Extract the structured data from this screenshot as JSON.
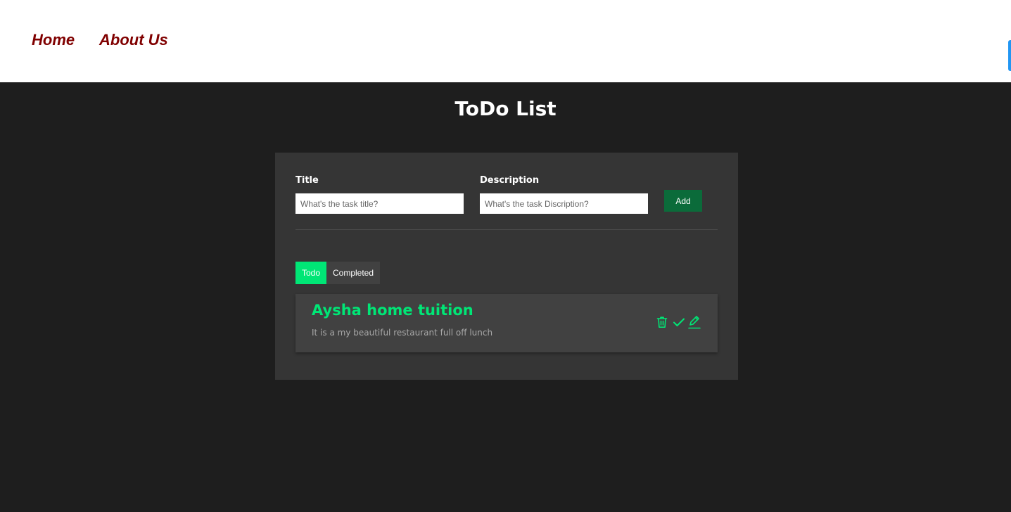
{
  "nav": {
    "home_label": "Home",
    "about_label": "About Us"
  },
  "page": {
    "title": "ToDo List"
  },
  "form": {
    "title_label": "Title",
    "title_placeholder": "What's the task title?",
    "title_value": "",
    "description_label": "Description",
    "description_placeholder": "What's the task Discription?",
    "description_value": "",
    "add_label": "Add"
  },
  "tabs": [
    {
      "label": "Todo",
      "active": true
    },
    {
      "label": "Completed",
      "active": false
    }
  ],
  "todos": [
    {
      "title": "Aysha home tuition",
      "description": "It is a my beautiful restaurant full off lunch",
      "icons": [
        "trash-icon",
        "check-icon",
        "pencil-icon"
      ]
    }
  ],
  "colors": {
    "accent": "#00e676",
    "nav_text": "#800000",
    "add_button": "#0b6b3a",
    "background": "#1e1e1e",
    "panel": "#353535",
    "item": "#414141"
  }
}
